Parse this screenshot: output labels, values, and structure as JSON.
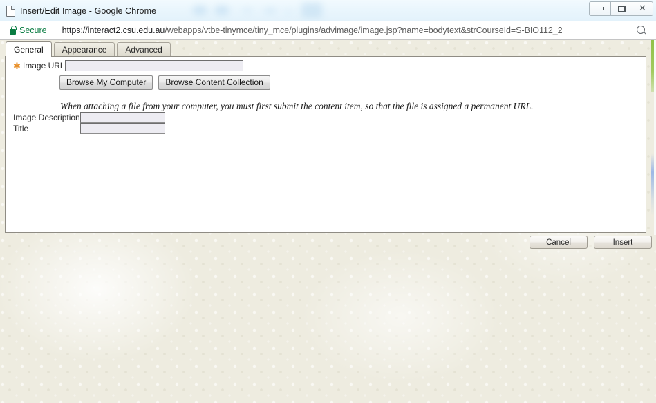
{
  "window": {
    "title": "Insert/Edit Image - Google Chrome",
    "icon": "page-icon",
    "minimize_label": "",
    "maximize_label": "",
    "close_label": "✕"
  },
  "omnibox": {
    "security_label": "Secure",
    "lock_icon": "lock-icon",
    "url_host": "https://interact2.csu.edu.au",
    "url_path": "/webapps/vtbe-tinymce/tiny_mce/plugins/advimage/image.jsp?name=bodytext&strCourseId=S-BIO112_2",
    "zoom_icon": "magnifier-icon"
  },
  "dialog": {
    "tabs": [
      {
        "label": "General",
        "active": true
      },
      {
        "label": "Appearance",
        "active": false
      },
      {
        "label": "Advanced",
        "active": false
      }
    ],
    "fields": {
      "image_url": {
        "label": "Image URL",
        "required_marker": "✱",
        "value": "",
        "placeholder": ""
      },
      "image_description": {
        "label": "Image Description",
        "value": "",
        "placeholder": ""
      },
      "title": {
        "label": "Title",
        "value": "",
        "placeholder": ""
      }
    },
    "buttons": {
      "browse_my_computer": "Browse My Computer",
      "browse_content_collection": "Browse Content Collection"
    },
    "help_text": "When attaching a file from your computer, you must first submit the content item, so that the file is assigned a permanent URL.",
    "footer": {
      "cancel": "Cancel",
      "insert": "Insert"
    }
  },
  "colors": {
    "accent_orange": "#e8912d",
    "secure_green": "#0a7c42",
    "page_beige": "#eeece0",
    "edge_green": "#8bbf3f",
    "edge_blue": "#9db8e6"
  }
}
